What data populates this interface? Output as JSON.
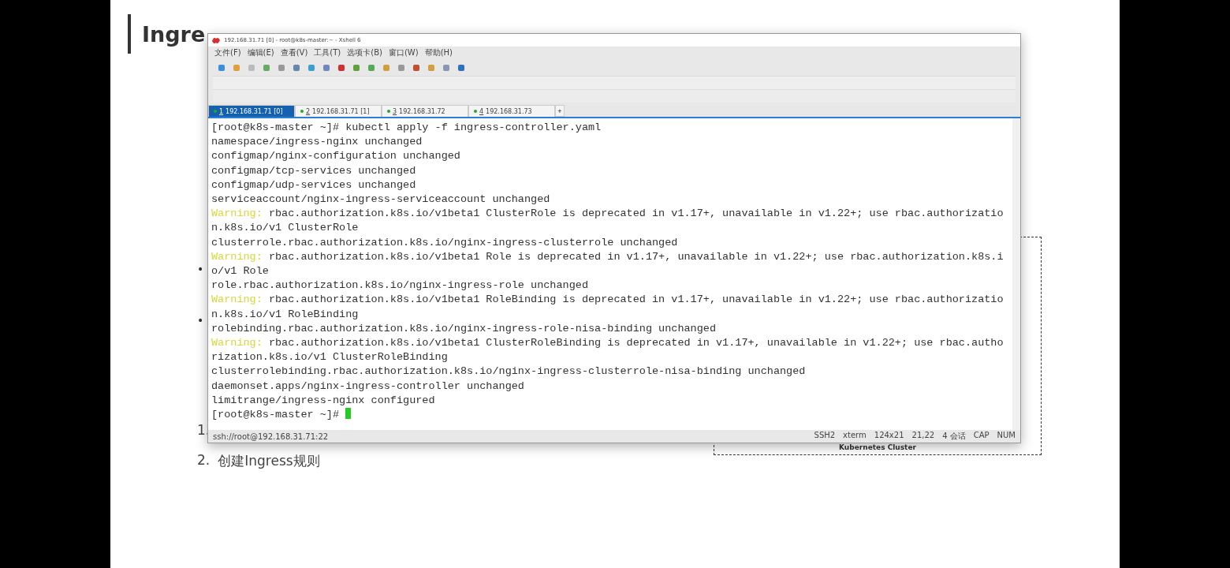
{
  "slide": {
    "title": "Ingre",
    "bullets": [
      "•",
      "•"
    ],
    "steps": [
      {
        "number": "1."
      },
      {
        "number": "2.",
        "text": "创建Ingress规则"
      }
    ],
    "diagram": {
      "label": "Kubernetes Cluster"
    }
  },
  "window": {
    "title": "192.168.31.71 [0] - root@k8s-master:~ - Xshell 6",
    "menu": [
      "文件(F)",
      "编辑(E)",
      "查看(V)",
      "工具(T)",
      "选项卡(B)",
      "窗口(W)",
      "帮助(H)"
    ],
    "tabs": [
      {
        "number": "1",
        "label": "192.168.31.71 [0]",
        "selected": true
      },
      {
        "number": "2",
        "label": "192.168.31.71 [1]",
        "selected": false
      },
      {
        "number": "3",
        "label": "192.168.31.72",
        "selected": false
      },
      {
        "number": "4",
        "label": "192.168.31.73",
        "selected": false
      }
    ],
    "new_tab": "+",
    "terminal": {
      "lines": [
        {
          "kind": "plain",
          "text": "[root@k8s-master ~]# kubectl apply -f ingress-controller.yaml"
        },
        {
          "kind": "plain",
          "text": "namespace/ingress-nginx unchanged"
        },
        {
          "kind": "plain",
          "text": "configmap/nginx-configuration unchanged"
        },
        {
          "kind": "plain",
          "text": "configmap/tcp-services unchanged"
        },
        {
          "kind": "plain",
          "text": "configmap/udp-services unchanged"
        },
        {
          "kind": "plain",
          "text": "serviceaccount/nginx-ingress-serviceaccount unchanged"
        },
        {
          "kind": "warning",
          "prefix": "Warning:",
          "text": " rbac.authorization.k8s.io/v1beta1 ClusterRole is deprecated in v1.17+, unavailable in v1.22+; use rbac.authorizatio"
        },
        {
          "kind": "plain",
          "text": "n.k8s.io/v1 ClusterRole"
        },
        {
          "kind": "plain",
          "text": "clusterrole.rbac.authorization.k8s.io/nginx-ingress-clusterrole unchanged"
        },
        {
          "kind": "warning",
          "prefix": "Warning:",
          "text": " rbac.authorization.k8s.io/v1beta1 Role is deprecated in v1.17+, unavailable in v1.22+; use rbac.authorization.k8s.i"
        },
        {
          "kind": "plain",
          "text": "o/v1 Role"
        },
        {
          "kind": "plain",
          "text": "role.rbac.authorization.k8s.io/nginx-ingress-role unchanged"
        },
        {
          "kind": "warning",
          "prefix": "Warning:",
          "text": " rbac.authorization.k8s.io/v1beta1 RoleBinding is deprecated in v1.17+, unavailable in v1.22+; use rbac.authorizatio"
        },
        {
          "kind": "plain",
          "text": "n.k8s.io/v1 RoleBinding"
        },
        {
          "kind": "plain",
          "text": "rolebinding.rbac.authorization.k8s.io/nginx-ingress-role-nisa-binding unchanged"
        },
        {
          "kind": "warning",
          "prefix": "Warning:",
          "text": " rbac.authorization.k8s.io/v1beta1 ClusterRoleBinding is deprecated in v1.17+, unavailable in v1.22+; use rbac.autho"
        },
        {
          "kind": "plain",
          "text": "rization.k8s.io/v1 ClusterRoleBinding"
        },
        {
          "kind": "plain",
          "text": "clusterrolebinding.rbac.authorization.k8s.io/nginx-ingress-clusterrole-nisa-binding unchanged"
        },
        {
          "kind": "plain",
          "text": "daemonset.apps/nginx-ingress-controller unchanged"
        },
        {
          "kind": "plain",
          "text": "limitrange/ingress-nginx configured"
        }
      ],
      "prompt": "[root@k8s-master ~]#"
    },
    "status_bar": {
      "address": "ssh://root@192.168.31.71:22",
      "items": [
        "SSH2",
        "xterm",
        "124x21",
        "21,22",
        "4 会话",
        "CAP",
        "NUM"
      ]
    }
  }
}
